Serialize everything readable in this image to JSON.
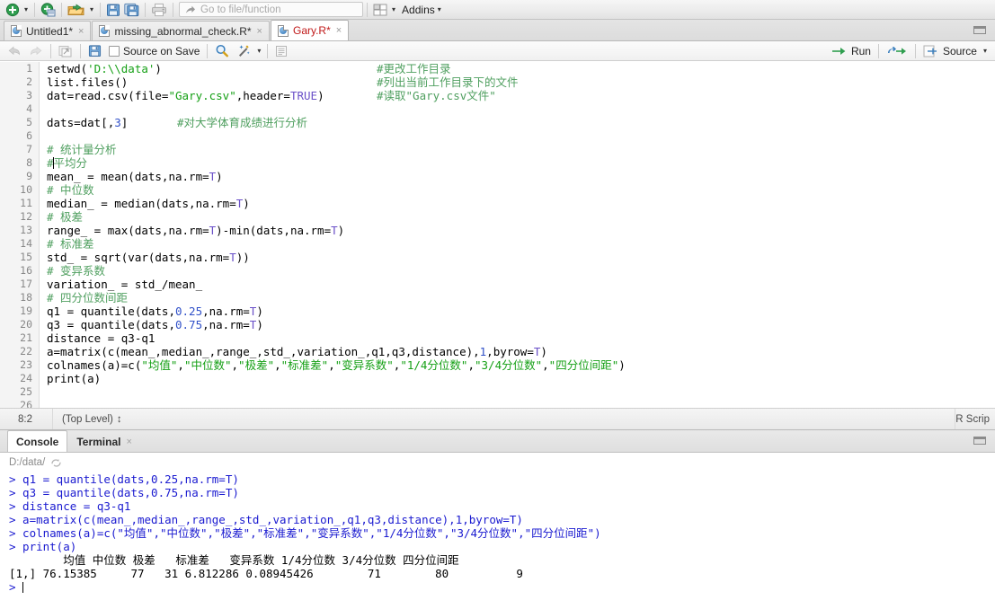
{
  "toolbar": {
    "new_file_icon": "new-document-icon",
    "new_project_icon": "new-project-icon",
    "open_file_icon": "open-folder-icon",
    "save_icon": "save-icon",
    "save_all_icon": "save-all-icon",
    "print_icon": "print-icon",
    "goto_icon": "goto-arrow-icon",
    "goto_placeholder": "Go to file/function",
    "workspace_panes_icon": "workspace-panes-icon",
    "addins_label": "Addins",
    "caret": "▾"
  },
  "source_pane": {
    "tabs": [
      {
        "label": "Untitled1*",
        "icon": "r-document-icon",
        "close": "×",
        "unsaved": true,
        "active": false
      },
      {
        "label": "missing_abnormal_check.R*",
        "icon": "r-document-icon",
        "close": "×",
        "unsaved": true,
        "active": false
      },
      {
        "label": "Gary.R*",
        "icon": "r-document-icon",
        "close": "×",
        "unsaved": true,
        "active": true
      }
    ],
    "editor_toolbar": {
      "back_icon": "back-arrow-icon",
      "forward_icon": "forward-arrow-icon",
      "popout_icon": "show-in-new-window-icon",
      "save_icon": "save-icon",
      "source_on_save_label": "Source on Save",
      "find_icon": "magnifier-icon",
      "code_tools_icon": "magic-wand-icon",
      "outline_icon": "document-outline-icon",
      "run_label": "Run",
      "run_icon": "run-arrow-icon",
      "rerun_icon": "rerun-icon",
      "source_label": "Source",
      "source_icon": "source-icon",
      "caret": "▾"
    },
    "status": {
      "position": "8:2",
      "scope": "(Top Level)",
      "scope_caret": "↕",
      "file_type": "R Scrip"
    }
  },
  "code": {
    "lines": [
      {
        "n": "1",
        "main": "setwd(<s>'D:\\\\data'</s>)",
        "comment": "#更改工作目录"
      },
      {
        "n": "2",
        "main": "list.files()",
        "comment": "#列出当前工作目录下的文件"
      },
      {
        "n": "3",
        "main": "dat=read.csv(file=<s>\"Gary.csv\"</s>,header=<c>TRUE</c>)",
        "comment": "#读取\"Gary.csv文件\""
      },
      {
        "n": "4",
        "main": "",
        "comment": ""
      },
      {
        "n": "5",
        "main": "dats=dat[,<n>3</n>]",
        "comment": "#对大学体育成绩进行分析",
        "comment_inline": true
      },
      {
        "n": "6",
        "main": "",
        "comment": ""
      },
      {
        "n": "7",
        "main": "<t># 统计量分析</t>",
        "comment": ""
      },
      {
        "n": "8",
        "main": "<t>#</t>|<t>平均分</t>",
        "comment": "",
        "cursor": true
      },
      {
        "n": "9",
        "main": "mean_ = mean(dats,na.rm=<c>T</c>)",
        "comment": ""
      },
      {
        "n": "10",
        "main": "<t># 中位数</t>",
        "comment": ""
      },
      {
        "n": "11",
        "main": "median_ = median(dats,na.rm=<c>T</c>)",
        "comment": ""
      },
      {
        "n": "12",
        "main": "<t># 极差</t>",
        "comment": ""
      },
      {
        "n": "13",
        "main": "range_ = max(dats,na.rm=<c>T</c>)-min(dats,na.rm=<c>T</c>)",
        "comment": ""
      },
      {
        "n": "14",
        "main": "<t># 标准差</t>",
        "comment": ""
      },
      {
        "n": "15",
        "main": "std_ = sqrt(var(dats,na.rm=<c>T</c>))",
        "comment": ""
      },
      {
        "n": "16",
        "main": "<t># 变异系数</t>",
        "comment": ""
      },
      {
        "n": "17",
        "main": "variation_ = std_/mean_",
        "comment": ""
      },
      {
        "n": "18",
        "main": "<t># 四分位数间距</t>",
        "comment": ""
      },
      {
        "n": "19",
        "main": "q1 = quantile(dats,<n>0.25</n>,na.rm=<c>T</c>)",
        "comment": ""
      },
      {
        "n": "20",
        "main": "q3 = quantile(dats,<n>0.75</n>,na.rm=<c>T</c>)",
        "comment": ""
      },
      {
        "n": "21",
        "main": "distance = q3-q1",
        "comment": ""
      },
      {
        "n": "22",
        "main": "a=matrix(c(mean_,median_,range_,std_,variation_,q1,q3,distance),<n>1</n>,byrow=<c>T</c>)",
        "comment": ""
      },
      {
        "n": "23",
        "main": "colnames(a)=c(<s>\"均值\"</s>,<s>\"中位数\"</s>,<s>\"极差\"</s>,<s>\"标准差\"</s>,<s>\"变异系数\"</s>,<s>\"1/4分位数\"</s>,<s>\"3/4分位数\"</s>,<s>\"四分位间距\"</s>)",
        "comment": ""
      },
      {
        "n": "24",
        "main": "print(a)",
        "comment": ""
      },
      {
        "n": "25",
        "main": "",
        "comment": ""
      },
      {
        "n": "26",
        "main": "",
        "comment": ""
      }
    ]
  },
  "console_pane": {
    "tabs": [
      {
        "label": "Console",
        "active": true,
        "close": ""
      },
      {
        "label": "Terminal",
        "active": false,
        "close": "×"
      }
    ],
    "path": "D:/data/",
    "path_icon": "refresh-icon",
    "lines": [
      {
        "kind": "cmd",
        "prompt": "> ",
        "text": "q1 = quantile(dats,0.25,na.rm=T)"
      },
      {
        "kind": "cmd",
        "prompt": "> ",
        "text": "q3 = quantile(dats,0.75,na.rm=T)"
      },
      {
        "kind": "cmd",
        "prompt": "> ",
        "text": "distance = q3-q1"
      },
      {
        "kind": "cmd",
        "prompt": "> ",
        "text": "a=matrix(c(mean_,median_,range_,std_,variation_,q1,q3,distance),1,byrow=T)"
      },
      {
        "kind": "cmd",
        "prompt": "> ",
        "text": "colnames(a)=c(\"均值\",\"中位数\",\"极差\",\"标准差\",\"变异系数\",\"1/4分位数\",\"3/4分位数\",\"四分位间距\")"
      },
      {
        "kind": "cmd",
        "prompt": "> ",
        "text": "print(a)"
      },
      {
        "kind": "out",
        "prompt": "",
        "text": "        均值 中位数 极差   标准差   变异系数 1/4分位数 3/4分位数 四分位间距"
      },
      {
        "kind": "out",
        "prompt": "",
        "text": "[1,] 76.15385     77   31 6.812286 0.08945426        71        80          9"
      }
    ],
    "final_prompt": "> "
  },
  "console_table": {
    "row_label": "[1,]",
    "headers": [
      "均值",
      "中位数",
      "极差",
      "标准差",
      "变异系数",
      "1/4分位数",
      "3/4分位数",
      "四分位间距"
    ],
    "values": [
      "76.15385",
      "77",
      "31",
      "6.812286",
      "0.08945426",
      "71",
      "80",
      "9"
    ]
  },
  "colors": {
    "string": "#15a015",
    "comment": "#4f9f5f",
    "number": "#3050c8",
    "constant": "#6a50c8",
    "console_command": "#1a1ad0",
    "tab_unsaved": "#c01919"
  }
}
